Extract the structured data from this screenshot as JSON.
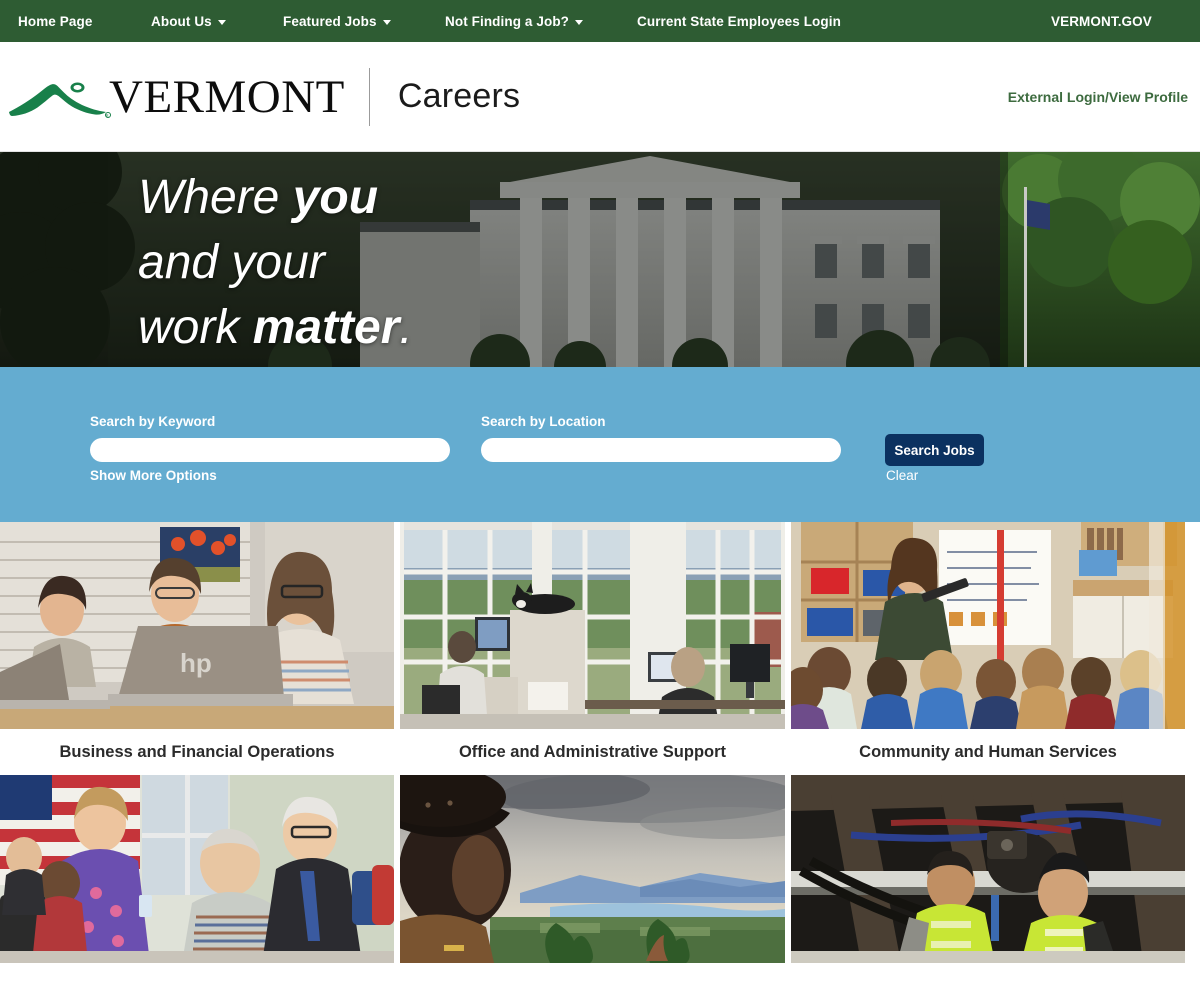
{
  "topnav": {
    "items": [
      {
        "label": "Home Page",
        "has_caret": false
      },
      {
        "label": "About Us",
        "has_caret": true
      },
      {
        "label": "Featured Jobs",
        "has_caret": true
      },
      {
        "label": "Not Finding a Job?",
        "has_caret": true
      },
      {
        "label": "Current State Employees Login",
        "has_caret": false
      },
      {
        "label": "VERMONT.GOV",
        "has_caret": false
      }
    ],
    "background_color": "#2e5c33",
    "text_color": "#ffffff"
  },
  "header": {
    "logo_wordmark": "VERMONT",
    "site_title": "Careers",
    "logo_icon": "vermont-mountain-logo",
    "external_login_label": "External Login/View Profile",
    "link_color": "#3d6b3f"
  },
  "hero": {
    "line1_a": "Where ",
    "line1_b": "you",
    "line2": "and your",
    "line3_a": "work ",
    "line3_b": "matter",
    "line3_c": ".",
    "image_description": "Vermont State House with columns, flagpole and trees"
  },
  "search": {
    "keyword_label": "Search by Keyword",
    "keyword_value": "",
    "keyword_placeholder": "",
    "location_label": "Search by Location",
    "location_value": "",
    "location_placeholder": "",
    "show_more_label": "Show More Options",
    "search_button_label": "Search Jobs",
    "clear_label": "Clear",
    "panel_color": "#64acd0",
    "button_color": "#0b3160"
  },
  "categories": [
    {
      "label": "Business and Financial Operations",
      "image": "three-women-at-laptops-in-office"
    },
    {
      "label": "Office and Administrative Support",
      "image": "office-cubicles-with-tall-windows-and-cat"
    },
    {
      "label": "Community and Human Services",
      "image": "teacher-reading-to-children-in-classroom"
    },
    {
      "label": "",
      "image": "caregivers-with-resident-and-american-flag"
    },
    {
      "label": "",
      "image": "ranger-in-hat-overlooking-lake-valley"
    },
    {
      "label": "",
      "image": "two-mechanics-in-hi-vis-vests-under-vehicle"
    }
  ]
}
